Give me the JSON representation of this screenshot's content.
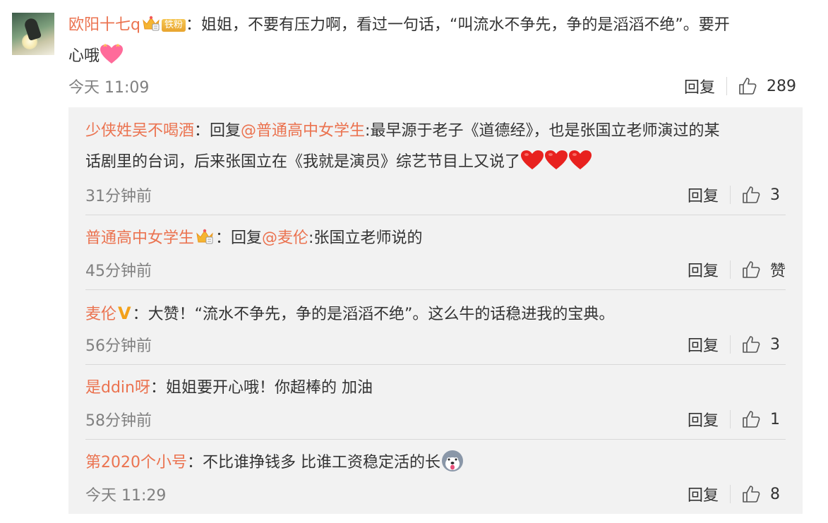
{
  "main_comment": {
    "username": "欧阳十七q",
    "badge": "铁粉",
    "colon": "：",
    "text_line1": "姐姐，不要有压力啊，看过一句话，“叫流水不争先，争的是滔滔不绝”。要开",
    "text_line2": "心哦",
    "time": "今天 11:09",
    "reply_label": "回复",
    "likes": "289"
  },
  "replies": [
    {
      "username": "少侠姓吴不喝酒",
      "reply_prefix": "：回复",
      "mention": "@普通高中女学生",
      "text_line1": ":最早源于老子《道德经》，也是张国立老师演过的某",
      "text_line2": "话剧里的台词，后来张国立在《我就是演员》综艺节目上又说了",
      "time": "31分钟前",
      "reply_label": "回复",
      "likes": "3"
    },
    {
      "username": "普通高中女学生",
      "reply_prefix": "：回复",
      "mention": "@麦伦",
      "text": ":张国立老师说的",
      "time": "45分钟前",
      "reply_label": "回复",
      "likes": "赞"
    },
    {
      "username": "麦伦",
      "verified": "V",
      "text": "：大赞！“流水不争先，争的是滔滔不绝”。这么牛的话稳进我的宝典。",
      "time": "56分钟前",
      "reply_label": "回复",
      "likes": "3"
    },
    {
      "username": "是ddin呀",
      "text": "：姐姐要开心哦！你超棒的  加油",
      "time": "58分钟前",
      "reply_label": "回复",
      "likes": "1"
    },
    {
      "username": "第2020个小号",
      "text": "：不比谁挣钱多 比谁工资稳定活的长",
      "time": "今天 11:29",
      "reply_label": "回复",
      "likes": "8"
    }
  ],
  "colors": {
    "username": "#eb7350",
    "meta": "#808080",
    "reply_bg": "#f2f2f2",
    "badge_gold": "#f5c653",
    "verified": "#f3a11a"
  }
}
